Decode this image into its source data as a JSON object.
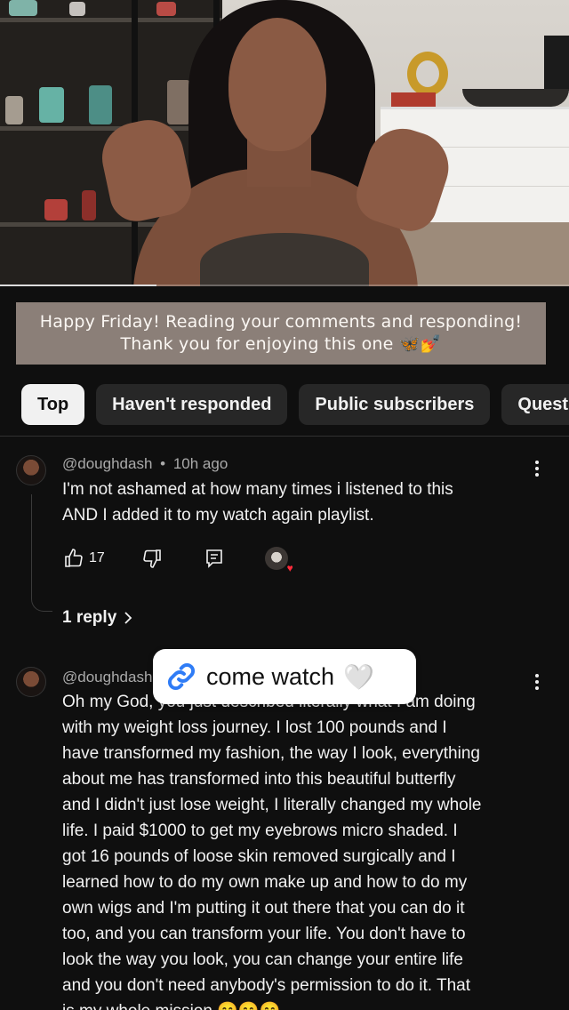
{
  "video": {
    "progress_fraction": 0.275
  },
  "pinned_banner": {
    "line1": "Happy Friday! Reading your comments and responding!",
    "line2": "Thank you for enjoying this one 🦋💅"
  },
  "filters": [
    {
      "label": "Top",
      "active": true
    },
    {
      "label": "Haven't responded",
      "active": false
    },
    {
      "label": "Public subscribers",
      "active": false
    },
    {
      "label": "Quest",
      "active": false
    }
  ],
  "comments": [
    {
      "author": "@doughdash",
      "time": "10h ago",
      "separator": "•",
      "text_lines": [
        "I'm not ashamed at how many times i listened to this",
        "AND I added it to my watch again playlist."
      ],
      "like_count": "17",
      "replies_label": "1 reply"
    },
    {
      "author": "@doughdash",
      "text_lines": [
        "Oh my God, you just described literally what I am doing",
        "with my weight loss journey. I lost 100 pounds and I",
        "have transformed my fashion, the way I look, everything",
        "about me has transformed into this beautiful butterfly",
        "and I didn't just lose weight, I literally changed my whole",
        "life. I paid $1000 to get my eyebrows micro shaded. I",
        "got 16 pounds of loose skin removed surgically and I",
        "learned how to do my own make up and how to do my",
        "own wigs and I'm putting it out there that you can do it",
        "too, and you can transform your life. You don't have to",
        "look the way you look, you can change your entire life",
        "and you don't need anybody's permission to do it. That",
        "is my whole mission 😊😊😊"
      ]
    }
  ],
  "sticker": {
    "text": "come watch",
    "icon": "link-icon",
    "heart": "🤍"
  },
  "colors": {
    "background": "#0f0f0f",
    "chip_bg": "#272727",
    "chip_active_bg": "#f1f1f1",
    "banner_bg": "#8b7f78",
    "creator_heart": "#ff2b3b"
  }
}
